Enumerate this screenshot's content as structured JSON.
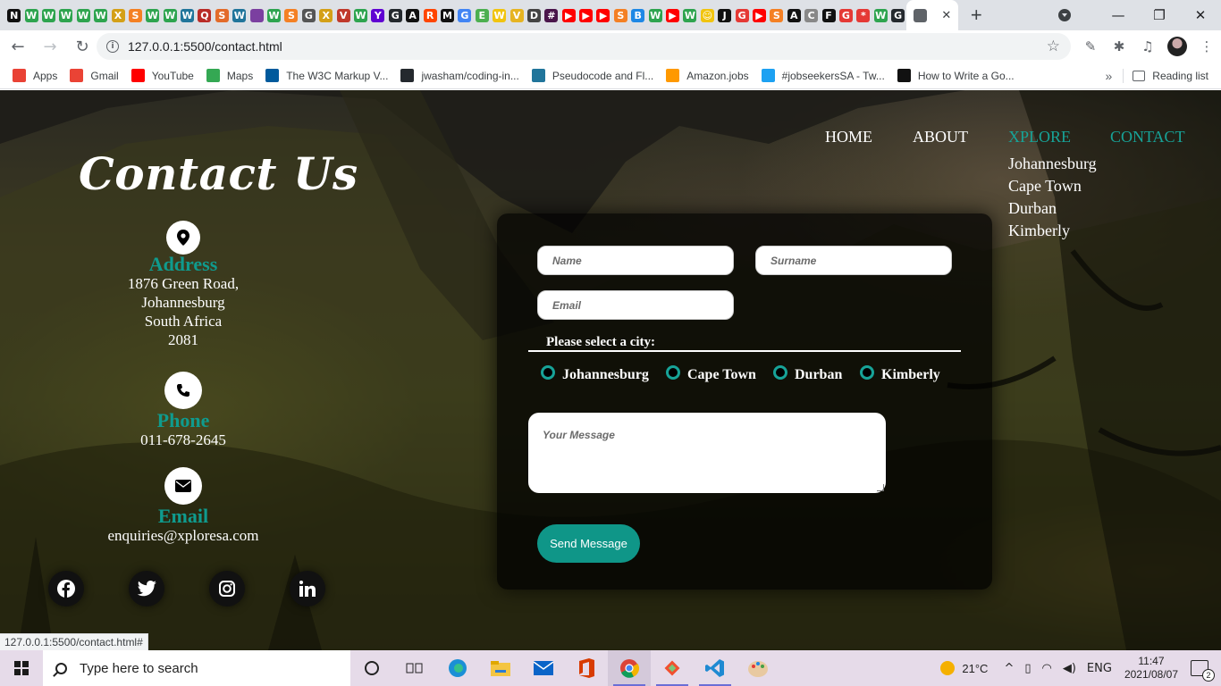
{
  "browser": {
    "tabs": [
      {
        "icon": "notion-icon",
        "letter": "N",
        "color": "#111111"
      },
      {
        "icon": "wordpress-w-icon",
        "letter": "W",
        "color": "#2ea44f"
      },
      {
        "icon": "wordpress-w-icon",
        "letter": "W",
        "color": "#2ea44f"
      },
      {
        "icon": "wordpress-w-icon",
        "letter": "W",
        "color": "#2ea44f"
      },
      {
        "icon": "wordpress-w-icon",
        "letter": "W",
        "color": "#2ea44f"
      },
      {
        "icon": "wordpress-w-icon",
        "letter": "W",
        "color": "#2ea44f"
      },
      {
        "icon": "x-icon",
        "letter": "X",
        "color": "#d4a017"
      },
      {
        "icon": "stack-icon",
        "letter": "S",
        "color": "#f48024"
      },
      {
        "icon": "wordpress-w-icon",
        "letter": "W",
        "color": "#2ea44f"
      },
      {
        "icon": "wordpress-w-icon",
        "letter": "W",
        "color": "#2ea44f"
      },
      {
        "icon": "wp-logo-icon",
        "letter": "W",
        "color": "#21759b"
      },
      {
        "icon": "quora-icon",
        "letter": "Q",
        "color": "#b92b27"
      },
      {
        "icon": "link-icon",
        "letter": "S",
        "color": "#e36b2a"
      },
      {
        "icon": "wp-logo-icon",
        "letter": "W",
        "color": "#21759b"
      },
      {
        "icon": "purple-square-icon",
        "letter": "",
        "color": "#7b3fa0"
      },
      {
        "icon": "wordpress-w-icon",
        "letter": "W",
        "color": "#2ea44f"
      },
      {
        "icon": "stack-icon",
        "letter": "S",
        "color": "#f48024"
      },
      {
        "icon": "globe-icon",
        "letter": "G",
        "color": "#555555"
      },
      {
        "icon": "x-icon",
        "letter": "X",
        "color": "#d4a017"
      },
      {
        "icon": "vsco-icon",
        "letter": "V",
        "color": "#c0392b"
      },
      {
        "icon": "wordpress-w-icon",
        "letter": "W",
        "color": "#2ea44f"
      },
      {
        "icon": "yahoo-mail-icon",
        "letter": "Y",
        "color": "#6001d2"
      },
      {
        "icon": "github-icon",
        "letter": "G",
        "color": "#24292e"
      },
      {
        "icon": "a-icon",
        "letter": "A",
        "color": "#111111"
      },
      {
        "icon": "reddit-icon",
        "letter": "R",
        "color": "#ff4500"
      },
      {
        "icon": "m-icon",
        "letter": "M",
        "color": "#111111"
      },
      {
        "icon": "google-icon",
        "letter": "G",
        "color": "#4285f4"
      },
      {
        "icon": "e-icon",
        "letter": "E",
        "color": "#4caf50"
      },
      {
        "icon": "yellow-w-icon",
        "letter": "W",
        "color": "#f1c40f"
      },
      {
        "icon": "yellow-chevron-icon",
        "letter": "V",
        "color": "#e6b422"
      },
      {
        "icon": "document-icon",
        "letter": "D",
        "color": "#444444"
      },
      {
        "icon": "slack-icon",
        "letter": "#",
        "color": "#4a154b"
      },
      {
        "icon": "youtube-icon",
        "letter": "▶",
        "color": "#ff0000"
      },
      {
        "icon": "youtube-icon",
        "letter": "▶",
        "color": "#ff0000"
      },
      {
        "icon": "youtube-icon",
        "letter": "▶",
        "color": "#ff0000"
      },
      {
        "icon": "stack-icon",
        "letter": "S",
        "color": "#f48024"
      },
      {
        "icon": "bookmark-icon",
        "letter": "B",
        "color": "#1e88e5"
      },
      {
        "icon": "wordpress-w-icon",
        "letter": "W",
        "color": "#2ea44f"
      },
      {
        "icon": "youtube-icon",
        "letter": "▶",
        "color": "#ff0000"
      },
      {
        "icon": "wordpress-w-icon",
        "letter": "W",
        "color": "#2ea44f"
      },
      {
        "icon": "emoji-icon",
        "letter": "☺",
        "color": "#f1c40f"
      },
      {
        "icon": "jb-icon",
        "letter": "J",
        "color": "#111111"
      },
      {
        "icon": "gift-icon",
        "letter": "G",
        "color": "#e53935"
      },
      {
        "icon": "youtube-icon",
        "letter": "▶",
        "color": "#ff0000"
      },
      {
        "icon": "stack-icon",
        "letter": "S",
        "color": "#f48024"
      },
      {
        "icon": "a-icon",
        "letter": "A",
        "color": "#111111"
      },
      {
        "icon": "cube-icon",
        "letter": "C",
        "color": "#888888"
      },
      {
        "icon": "f-icon",
        "letter": "F",
        "color": "#111111"
      },
      {
        "icon": "gift-icon",
        "letter": "G",
        "color": "#e53935"
      },
      {
        "icon": "asterisk-icon",
        "letter": "*",
        "color": "#e53935"
      },
      {
        "icon": "wordpress-w-icon",
        "letter": "W",
        "color": "#2ea44f"
      },
      {
        "icon": "github-icon",
        "letter": "G",
        "color": "#24292e"
      }
    ],
    "active_tab_icon": "html-file-icon",
    "url": "127.0.0.1:5500/contact.html",
    "bookmarks": [
      {
        "label": "Apps",
        "icon": "apps-grid-icon",
        "color": "#e94235"
      },
      {
        "label": "Gmail",
        "icon": "gmail-icon",
        "color": "#ea4335"
      },
      {
        "label": "YouTube",
        "icon": "youtube-icon",
        "color": "#ff0000"
      },
      {
        "label": "Maps",
        "icon": "maps-icon",
        "color": "#34a853"
      },
      {
        "label": "The W3C Markup V...",
        "icon": "w3c-icon",
        "color": "#005a9c"
      },
      {
        "label": "jwasham/coding-in...",
        "icon": "github-icon",
        "color": "#24292e"
      },
      {
        "label": "Pseudocode and Fl...",
        "icon": "wp-logo-icon",
        "color": "#21759b"
      },
      {
        "label": "Amazon.jobs",
        "icon": "amazon-icon",
        "color": "#ff9900"
      },
      {
        "label": "#jobseekersSA - Tw...",
        "icon": "twitter-icon",
        "color": "#1da1f2"
      },
      {
        "label": "How to Write a Go...",
        "icon": "a-icon",
        "color": "#111111"
      }
    ],
    "reading_list": "Reading list",
    "status_url": "127.0.0.1:5500/contact.html#"
  },
  "page": {
    "title": "Contact Us",
    "address": {
      "title": "Address",
      "lines": [
        "1876 Green Road,",
        "Johannesburg",
        "South Africa",
        "2081"
      ]
    },
    "phone": {
      "title": "Phone",
      "value": "011-678-2645"
    },
    "email": {
      "title": "Email",
      "value": "enquiries@xploresa.com"
    },
    "socials": [
      "facebook-icon",
      "twitter-icon",
      "instagram-icon",
      "linkedin-icon"
    ],
    "nav": {
      "home": "HOME",
      "about": "ABOUT",
      "xplore": "XPLORE",
      "contact": "CONTACT"
    },
    "dropdown": [
      "Johannesburg",
      "Cape Town",
      "Durban",
      "Kimberly"
    ],
    "form": {
      "name_placeholder": "Name",
      "surname_placeholder": "Surname",
      "email_placeholder": "Email",
      "city_legend": "Please select a city:",
      "cities": [
        "Johannesburg",
        "Cape Town",
        "Durban",
        "Kimberly"
      ],
      "message_placeholder": "Your Message",
      "send_label": "Send Message"
    },
    "accent_color": "#17a398"
  },
  "taskbar": {
    "search_placeholder": "Type here to search",
    "apps": [
      "task-view-icon",
      "edge-icon",
      "file-explorer-icon",
      "mail-icon",
      "office-icon",
      "chrome-icon",
      "git-icon",
      "vscode-icon",
      "paint-icon"
    ],
    "weather": "21°C",
    "language": "ENG",
    "time": "11:47",
    "date": "2021/08/07",
    "notifications": "2"
  }
}
